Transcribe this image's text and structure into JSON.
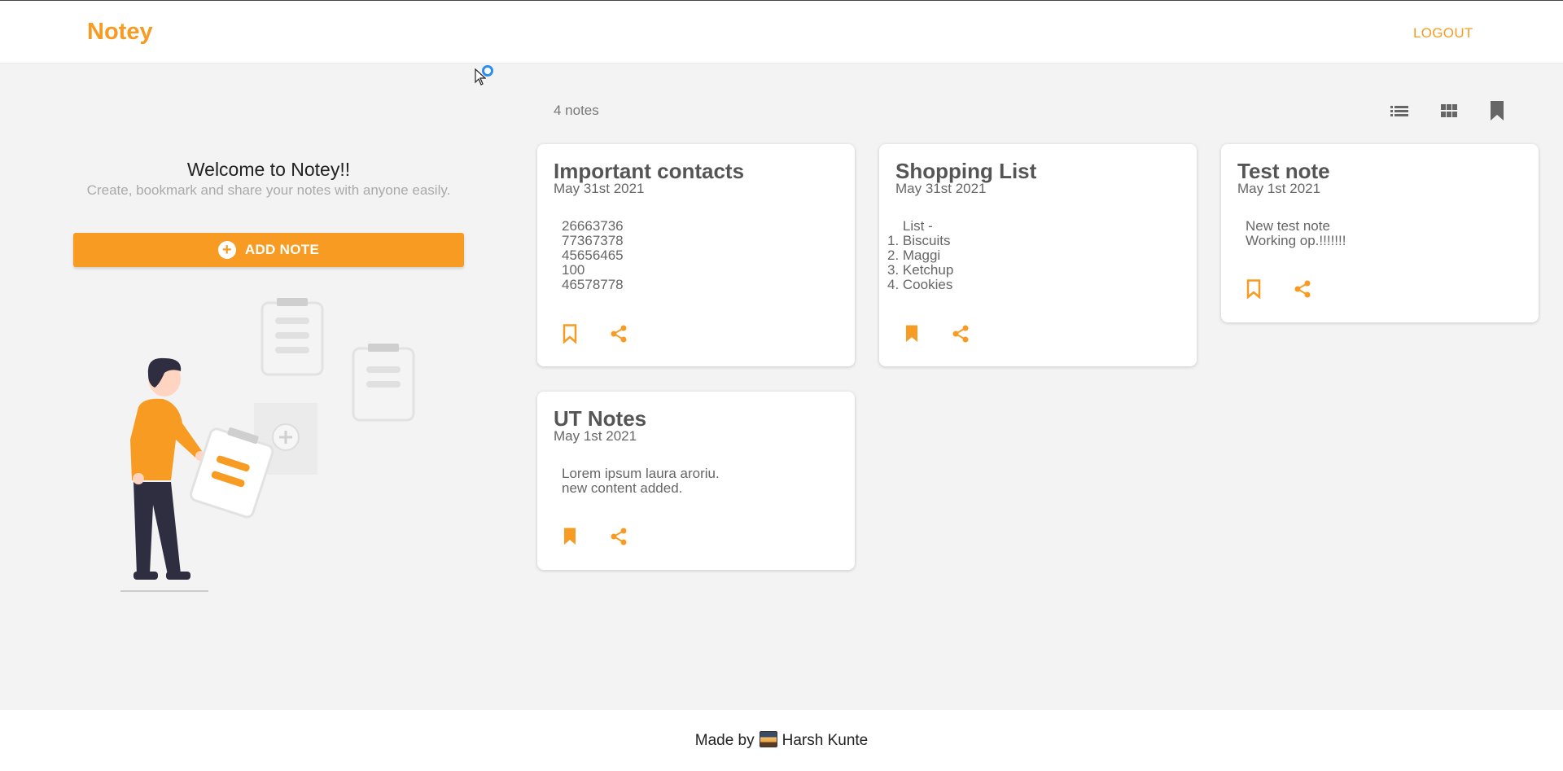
{
  "app": {
    "brand": "Notey",
    "logout_label": "LOGOUT"
  },
  "welcome": {
    "title": "Welcome to Notey!!",
    "subtitle": "Create, bookmark and share your notes with anyone easily.",
    "add_note_label": "ADD NOTE"
  },
  "toolbar": {
    "note_count": "4 notes",
    "icons": [
      "list-view-icon",
      "grid-view-icon",
      "bookmark-filter-icon"
    ]
  },
  "notes": [
    {
      "title": "Important contacts",
      "date": "May 31st 2021",
      "content": "26663736\n77367378\n45656465\n100\n46578778",
      "bookmarked": false
    },
    {
      "title": "Shopping List",
      "date": "May 31st 2021",
      "content": "    List -\n1. Biscuits\n2. Maggi\n3. Ketchup\n4. Cookies",
      "bookmarked": true
    },
    {
      "title": "Test note",
      "date": "May 1st 2021",
      "content": "New test note\nWorking op.!!!!!!!",
      "bookmarked": false
    },
    {
      "title": "UT Notes",
      "date": "May 1st 2021",
      "content": "Lorem ipsum laura aroriu.\nnew content added.",
      "bookmarked": true
    }
  ],
  "footer": {
    "made_by": "Made by",
    "author": "Harsh Kunte"
  },
  "colors": {
    "accent": "#f89b22",
    "background": "#f3f3f3",
    "card": "#ffffff"
  }
}
